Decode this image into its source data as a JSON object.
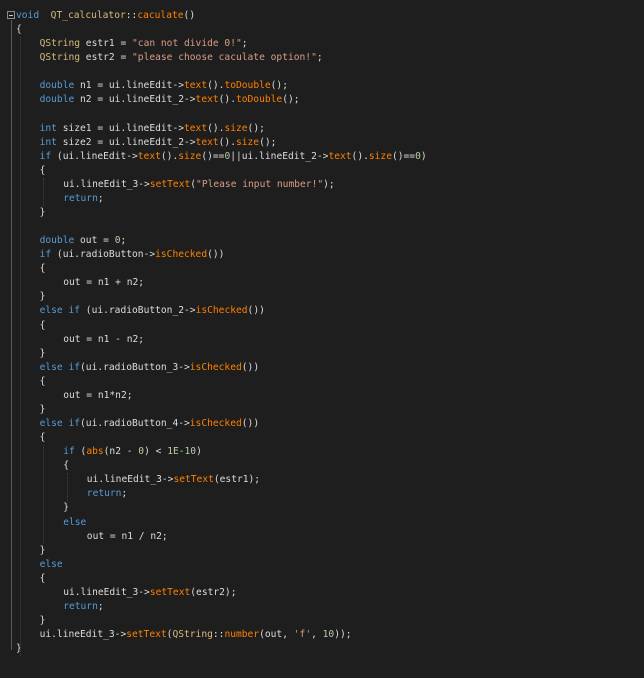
{
  "editor": {
    "lines": [
      {
        "indent": 0,
        "tokens": [
          [
            "kw",
            "void"
          ],
          [
            "",
            "  "
          ],
          [
            "cls",
            "QT_calculator"
          ],
          [
            "",
            "::"
          ],
          [
            "fn",
            "caculate"
          ],
          [
            "",
            "()"
          ]
        ]
      },
      {
        "indent": 0,
        "tokens": [
          [
            "",
            "{"
          ]
        ]
      },
      {
        "indent": 4,
        "tokens": [
          [
            "cls",
            "QString"
          ],
          [
            "",
            " estr1 = "
          ],
          [
            "str",
            "\"can not divide 0!\""
          ],
          [
            "",
            ";"
          ]
        ]
      },
      {
        "indent": 4,
        "tokens": [
          [
            "cls",
            "QString"
          ],
          [
            "",
            " estr2 = "
          ],
          [
            "str",
            "\"please choose caculate option!\""
          ],
          [
            "",
            ";"
          ]
        ]
      },
      {
        "indent": 0,
        "tokens": []
      },
      {
        "indent": 4,
        "tokens": [
          [
            "kw",
            "double"
          ],
          [
            "",
            " n1 = ui.lineEdit->"
          ],
          [
            "fn",
            "text"
          ],
          [
            "",
            "()."
          ],
          [
            "fn",
            "toDouble"
          ],
          [
            "",
            "();"
          ]
        ]
      },
      {
        "indent": 4,
        "tokens": [
          [
            "kw",
            "double"
          ],
          [
            "",
            " n2 = ui.lineEdit_2->"
          ],
          [
            "fn",
            "text"
          ],
          [
            "",
            "()."
          ],
          [
            "fn",
            "toDouble"
          ],
          [
            "",
            "();"
          ]
        ]
      },
      {
        "indent": 0,
        "tokens": []
      },
      {
        "indent": 4,
        "tokens": [
          [
            "kw",
            "int"
          ],
          [
            "",
            " size1 = ui.lineEdit->"
          ],
          [
            "fn",
            "text"
          ],
          [
            "",
            "()."
          ],
          [
            "fn",
            "size"
          ],
          [
            "",
            "();"
          ]
        ]
      },
      {
        "indent": 4,
        "tokens": [
          [
            "kw",
            "int"
          ],
          [
            "",
            " size2 = ui.lineEdit_2->"
          ],
          [
            "fn",
            "text"
          ],
          [
            "",
            "()."
          ],
          [
            "fn",
            "size"
          ],
          [
            "",
            "();"
          ]
        ]
      },
      {
        "indent": 4,
        "tokens": [
          [
            "kw",
            "if"
          ],
          [
            "",
            " (ui.lineEdit->"
          ],
          [
            "fn",
            "text"
          ],
          [
            "",
            "()."
          ],
          [
            "fn",
            "size"
          ],
          [
            "",
            "()=="
          ],
          [
            "num",
            "0"
          ],
          [
            "",
            "||ui.lineEdit_2->"
          ],
          [
            "fn",
            "text"
          ],
          [
            "",
            "()."
          ],
          [
            "fn",
            "size"
          ],
          [
            "",
            "()=="
          ],
          [
            "num",
            "0"
          ],
          [
            "",
            ")"
          ]
        ]
      },
      {
        "indent": 4,
        "tokens": [
          [
            "",
            "{"
          ]
        ]
      },
      {
        "indent": 8,
        "tokens": [
          [
            "",
            "ui.lineEdit_3->"
          ],
          [
            "fn",
            "setText"
          ],
          [
            "",
            "("
          ],
          [
            "str",
            "\"Please input number!\""
          ],
          [
            "",
            ");"
          ]
        ]
      },
      {
        "indent": 8,
        "tokens": [
          [
            "kw",
            "return"
          ],
          [
            "",
            ";"
          ]
        ]
      },
      {
        "indent": 4,
        "tokens": [
          [
            "",
            "}"
          ]
        ]
      },
      {
        "indent": 0,
        "tokens": []
      },
      {
        "indent": 4,
        "tokens": [
          [
            "kw",
            "double"
          ],
          [
            "",
            " out = "
          ],
          [
            "num",
            "0"
          ],
          [
            "",
            ";"
          ]
        ]
      },
      {
        "indent": 4,
        "tokens": [
          [
            "kw",
            "if"
          ],
          [
            "",
            " (ui.radioButton->"
          ],
          [
            "fn",
            "isChecked"
          ],
          [
            "",
            "())"
          ]
        ]
      },
      {
        "indent": 4,
        "tokens": [
          [
            "",
            "{"
          ]
        ]
      },
      {
        "indent": 8,
        "tokens": [
          [
            "",
            "out = n1 + n2;"
          ]
        ]
      },
      {
        "indent": 4,
        "tokens": [
          [
            "",
            "}"
          ]
        ]
      },
      {
        "indent": 4,
        "tokens": [
          [
            "kw",
            "else if"
          ],
          [
            "",
            " (ui.radioButton_2->"
          ],
          [
            "fn",
            "isChecked"
          ],
          [
            "",
            "())"
          ]
        ]
      },
      {
        "indent": 4,
        "tokens": [
          [
            "",
            "{"
          ]
        ]
      },
      {
        "indent": 8,
        "tokens": [
          [
            "",
            "out = n1 - n2;"
          ]
        ]
      },
      {
        "indent": 4,
        "tokens": [
          [
            "",
            "}"
          ]
        ]
      },
      {
        "indent": 4,
        "tokens": [
          [
            "kw",
            "else if"
          ],
          [
            "",
            "(ui.radioButton_3->"
          ],
          [
            "fn",
            "isChecked"
          ],
          [
            "",
            "())"
          ]
        ]
      },
      {
        "indent": 4,
        "tokens": [
          [
            "",
            "{"
          ]
        ]
      },
      {
        "indent": 8,
        "tokens": [
          [
            "",
            "out = n1*n2;"
          ]
        ]
      },
      {
        "indent": 4,
        "tokens": [
          [
            "",
            "}"
          ]
        ]
      },
      {
        "indent": 4,
        "tokens": [
          [
            "kw",
            "else if"
          ],
          [
            "",
            "(ui.radioButton_4->"
          ],
          [
            "fn",
            "isChecked"
          ],
          [
            "",
            "())"
          ]
        ]
      },
      {
        "indent": 4,
        "tokens": [
          [
            "",
            "{"
          ]
        ]
      },
      {
        "indent": 8,
        "tokens": [
          [
            "kw",
            "if"
          ],
          [
            "",
            " ("
          ],
          [
            "fn",
            "abs"
          ],
          [
            "",
            "(n2 - "
          ],
          [
            "num",
            "0"
          ],
          [
            "",
            ") < "
          ],
          [
            "num",
            "1E-10"
          ],
          [
            "",
            ")"
          ]
        ]
      },
      {
        "indent": 8,
        "tokens": [
          [
            "",
            "{"
          ]
        ]
      },
      {
        "indent": 12,
        "tokens": [
          [
            "",
            "ui.lineEdit_3->"
          ],
          [
            "fn",
            "setText"
          ],
          [
            "",
            "(estr1);"
          ]
        ]
      },
      {
        "indent": 12,
        "tokens": [
          [
            "kw",
            "return"
          ],
          [
            "",
            ";"
          ]
        ]
      },
      {
        "indent": 8,
        "tokens": [
          [
            "",
            "}"
          ]
        ]
      },
      {
        "indent": 8,
        "tokens": [
          [
            "kw",
            "else"
          ]
        ]
      },
      {
        "indent": 12,
        "tokens": [
          [
            "",
            "out = n1 / n2;"
          ]
        ]
      },
      {
        "indent": 4,
        "tokens": [
          [
            "",
            "}"
          ]
        ]
      },
      {
        "indent": 4,
        "tokens": [
          [
            "kw",
            "else"
          ]
        ]
      },
      {
        "indent": 4,
        "tokens": [
          [
            "",
            "{"
          ]
        ]
      },
      {
        "indent": 8,
        "tokens": [
          [
            "",
            "ui.lineEdit_3->"
          ],
          [
            "fn",
            "setText"
          ],
          [
            "",
            "(estr2);"
          ]
        ]
      },
      {
        "indent": 8,
        "tokens": [
          [
            "kw",
            "return"
          ],
          [
            "",
            ";"
          ]
        ]
      },
      {
        "indent": 4,
        "tokens": [
          [
            "",
            "}"
          ]
        ]
      },
      {
        "indent": 4,
        "tokens": [
          [
            "",
            "ui.lineEdit_3->"
          ],
          [
            "fn",
            "setText"
          ],
          [
            "",
            "("
          ],
          [
            "cls",
            "QString"
          ],
          [
            "",
            "::"
          ],
          [
            "fn",
            "number"
          ],
          [
            "",
            "(out, "
          ],
          [
            "str",
            "'f'"
          ],
          [
            "",
            ", "
          ],
          [
            "num",
            "10"
          ],
          [
            "",
            "));"
          ]
        ]
      },
      {
        "indent": 0,
        "tokens": [
          [
            "",
            "}"
          ]
        ]
      }
    ]
  },
  "colors": {
    "background": "#1e1e1e",
    "keyword": "#569cd6",
    "class": "#d7ba7d",
    "function": "#ff8000",
    "string": "#d69d85",
    "number": "#b5cea8",
    "text": "#dcdcdc"
  },
  "icons": {
    "fold": "collapse-minus-icon"
  }
}
